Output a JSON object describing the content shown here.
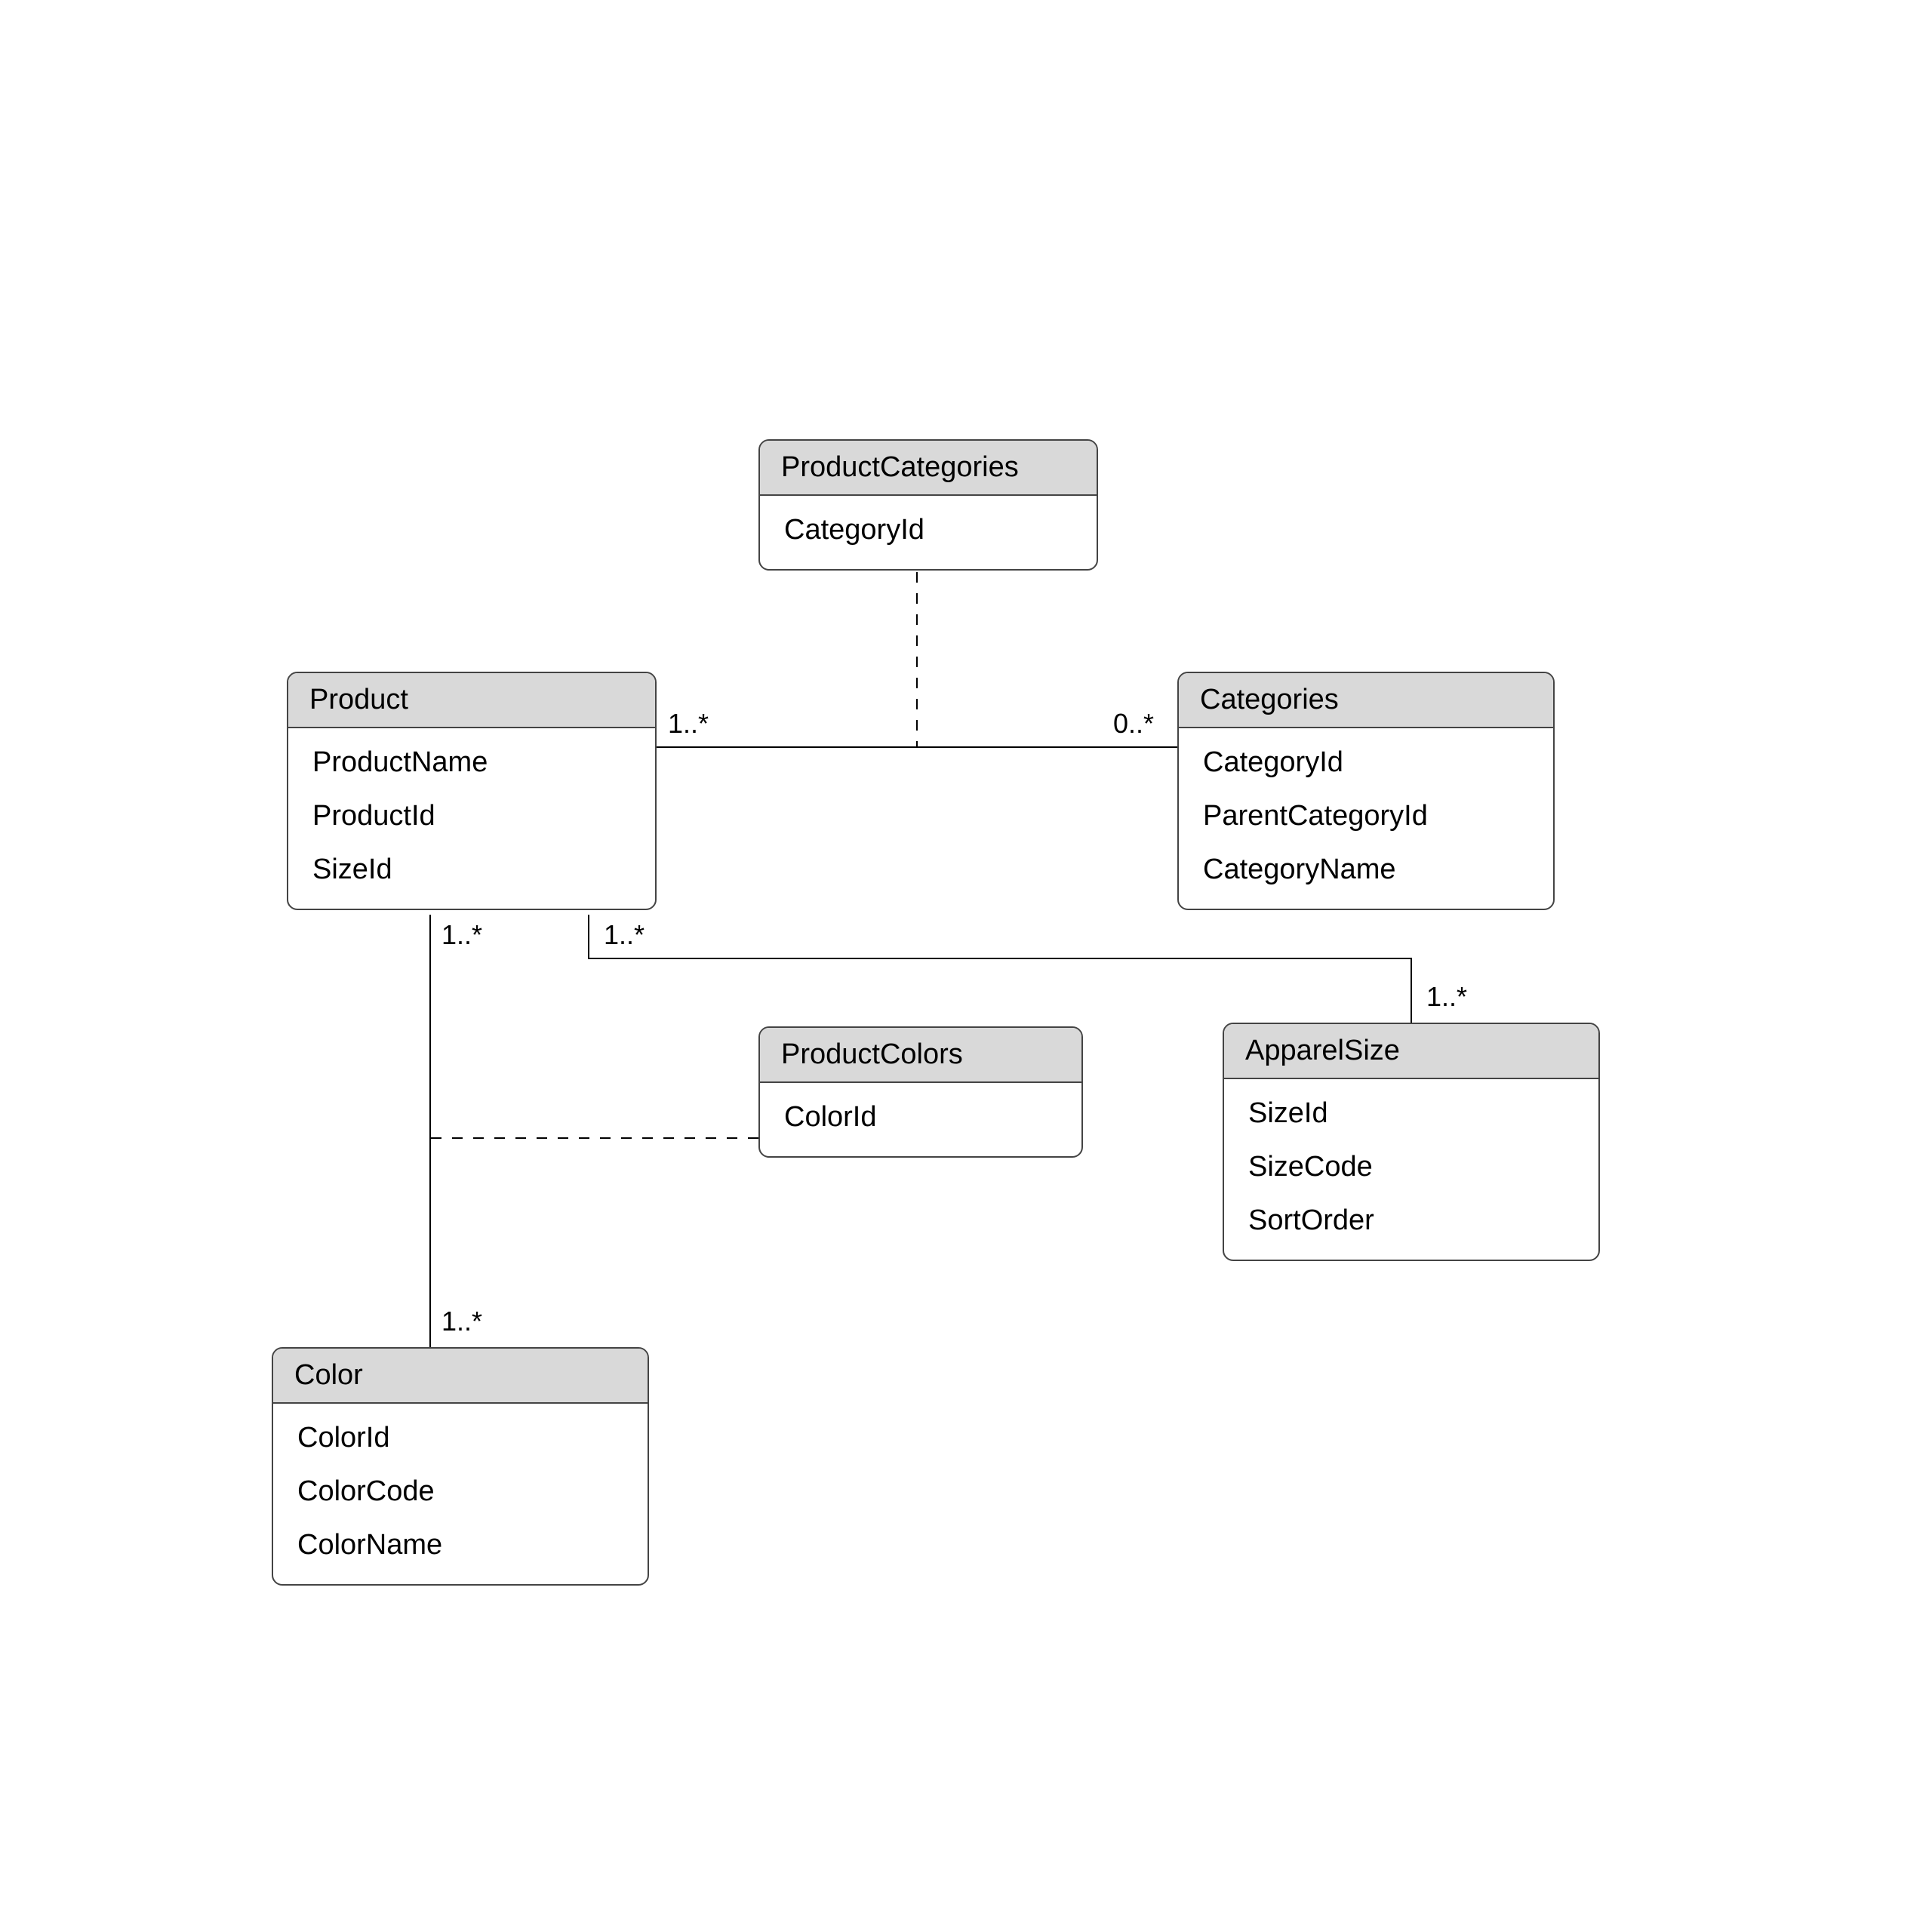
{
  "entities": {
    "product": {
      "title": "Product",
      "attrs": [
        "ProductName",
        "ProductId",
        "SizeId"
      ]
    },
    "productCategories": {
      "title": "ProductCategories",
      "attrs": [
        "CategoryId"
      ]
    },
    "categories": {
      "title": "Categories",
      "attrs": [
        "CategoryId",
        "ParentCategoryId",
        "CategoryName"
      ]
    },
    "productColors": {
      "title": "ProductColors",
      "attrs": [
        "ColorId"
      ]
    },
    "apparelSize": {
      "title": "ApparelSize",
      "attrs": [
        "SizeId",
        "SizeCode",
        "SortOrder"
      ]
    },
    "color": {
      "title": "Color",
      "attrs": [
        "ColorId",
        "ColorCode",
        "ColorName"
      ]
    }
  },
  "multiplicities": {
    "prodCat_left": "1..*",
    "prodCat_right": "0..*",
    "prodSize_left": "1..*",
    "prodSize_right": "1..*",
    "prodColor_top": "1..*",
    "prodColor_bottom": "1..*"
  }
}
